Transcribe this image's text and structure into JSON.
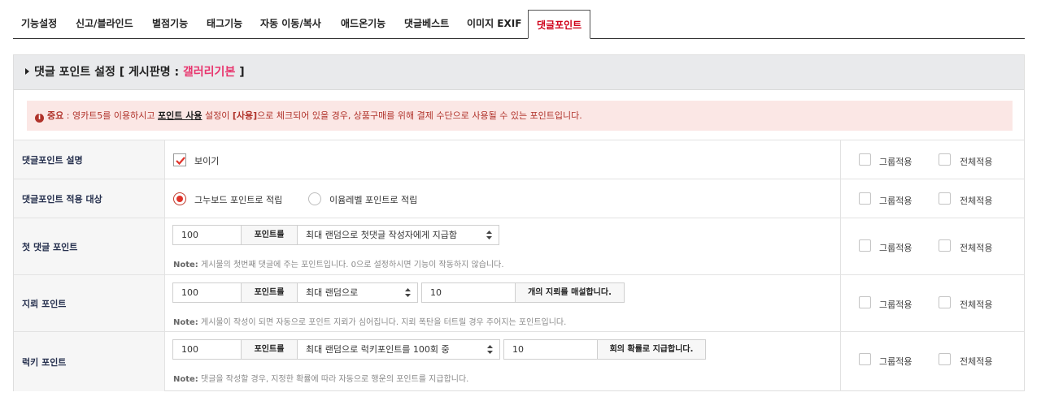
{
  "tabs": [
    {
      "label": "기능설정",
      "active": false
    },
    {
      "label": "신고/블라인드",
      "active": false
    },
    {
      "label": "별점기능",
      "active": false
    },
    {
      "label": "태그기능",
      "active": false
    },
    {
      "label": "자동 이동/복사",
      "active": false
    },
    {
      "label": "애드온기능",
      "active": false
    },
    {
      "label": "댓글베스트",
      "active": false
    },
    {
      "label": "이미지 EXIF",
      "active": false
    },
    {
      "label": "댓글포인트",
      "active": true
    }
  ],
  "panel": {
    "title_prefix": "댓글 포인트 설정 [ 게시판명 : ",
    "board_name": "갤러리기본",
    "title_suffix": " ]"
  },
  "notice": {
    "strong": "중요",
    "part1": " : 영카트5를 이용하시고 ",
    "emph": "포인트 사용",
    "part2": " 설정이 ",
    "value": "[사용]",
    "part3": "으로 체크되어 있을 경우, 상품구매를 위해 결제 수단으로 사용될 수 있는 포인트입니다."
  },
  "side": {
    "group_label": "그룹적용",
    "all_label": "전체적용"
  },
  "rows": {
    "description": {
      "label": "댓글포인트 설명",
      "show_label": "보이기",
      "checked": true
    },
    "target": {
      "label": "댓글포인트 적용 대상",
      "option1": "그누보드 포인트로 적립",
      "option2": "이윰레벨 포인트로 적립",
      "selected": "option1"
    },
    "first": {
      "label": "첫 댓글 포인트",
      "value": "100",
      "unit": "포인트를",
      "select": "최대 랜덤으로 첫댓글 작성자에게 지급함",
      "note_bold": "Note:",
      "note": " 게시물의 첫번째 댓글에 주는 포인트입니다. 0으로 설정하시면 기능이 작동하지 않습니다."
    },
    "mine": {
      "label": "지뢰 포인트",
      "value": "100",
      "unit": "포인트를",
      "select": "최대 랜덤으로",
      "count": "10",
      "suffix": "개의 지뢰를 매설합니다.",
      "note_bold": "Note:",
      "note": " 게시물이 작성이 되면 자동으로 포인트 지뢰가 심어집니다. 지뢰 폭탄을 터트릴 경우 주어지는 포인트입니다."
    },
    "lucky": {
      "label": "럭키 포인트",
      "value": "100",
      "unit": "포인트를",
      "select": "최대 랜덤으로 럭키포인트를 100회 중",
      "count": "10",
      "suffix": "회의 확률로 지급합니다.",
      "note_bold": "Note:",
      "note": " 댓글을 작성할 경우, 지정한 확률에 따라 자동으로 행운의 포인트를 지급합니다."
    }
  },
  "colors": {
    "accent": "#d0021b",
    "board_name": "#e8366e",
    "notice_bg": "#fbe7e5",
    "label_text": "#27314f"
  },
  "icons": [
    "caret-right-icon",
    "info-circle-icon",
    "check-icon",
    "select-arrows-icon"
  ]
}
